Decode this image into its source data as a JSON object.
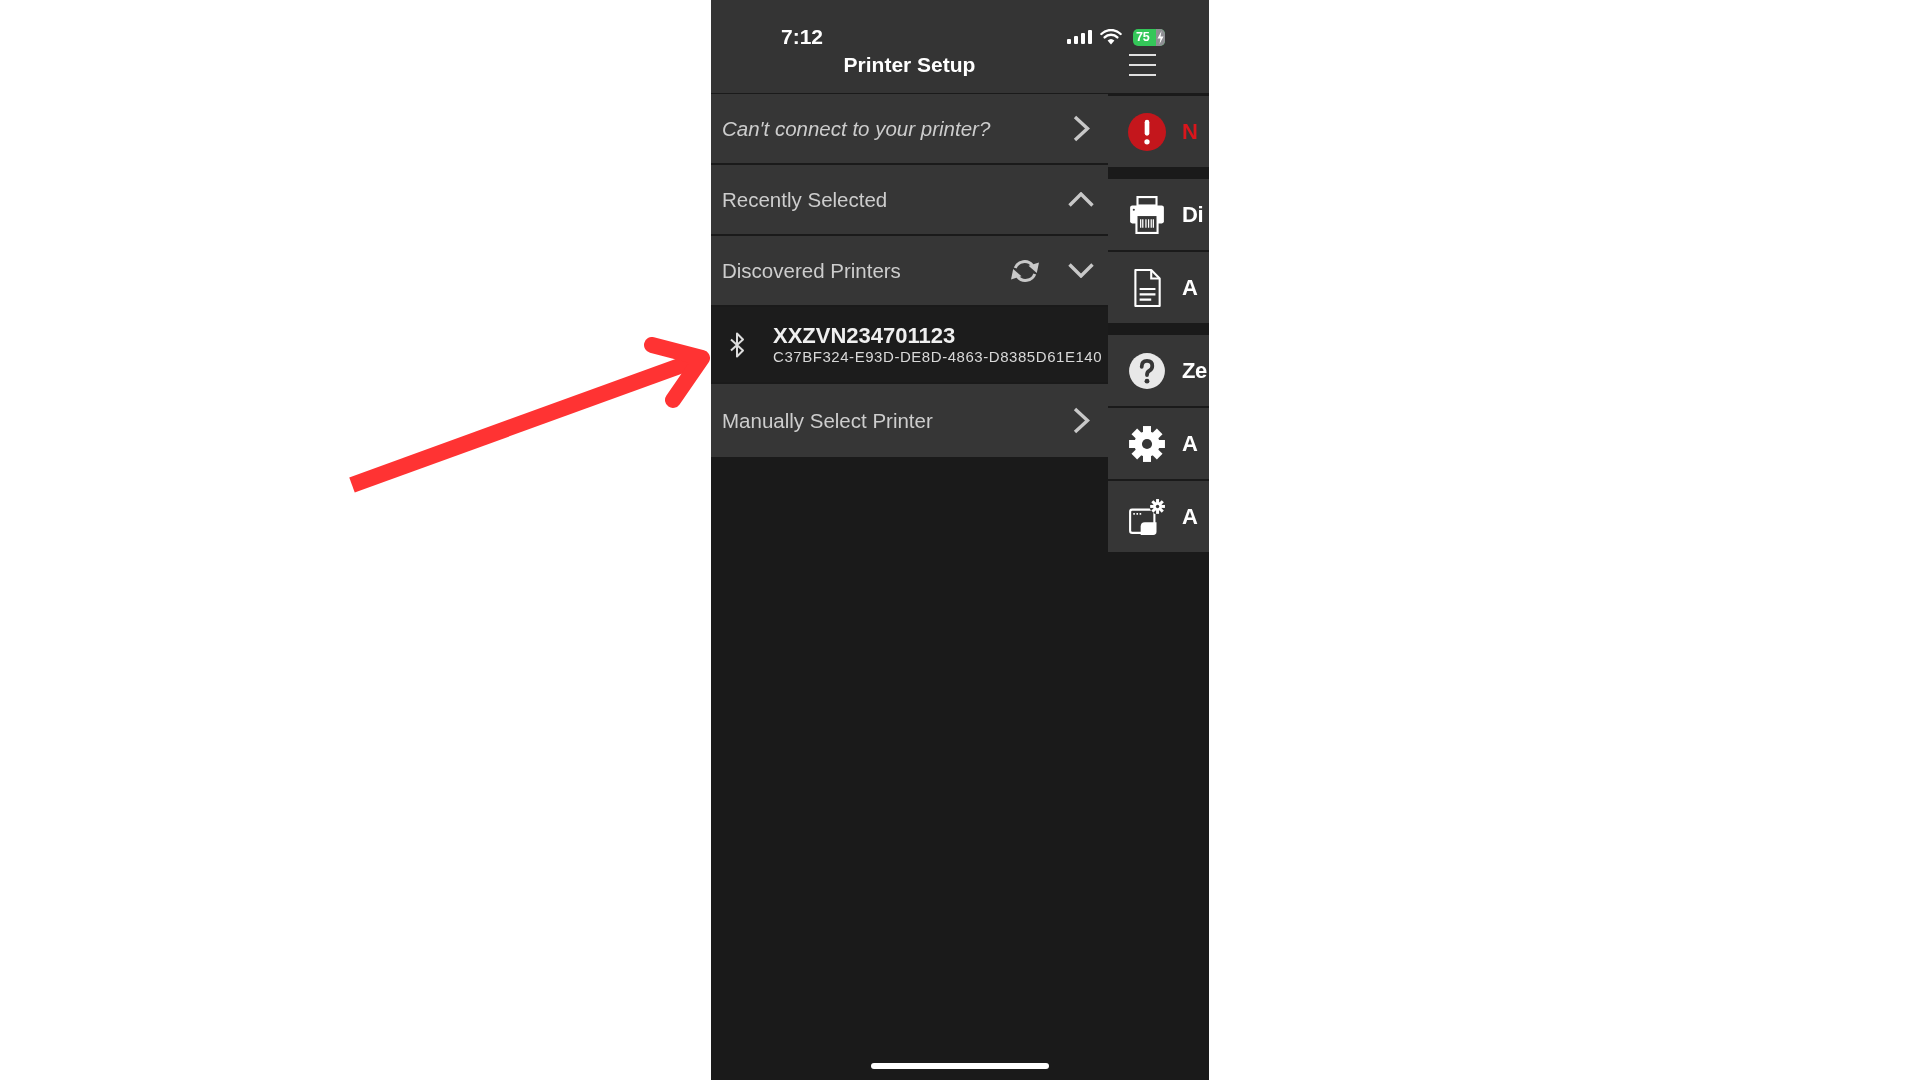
{
  "status_bar": {
    "time": "7:12",
    "battery": "75",
    "charging": true
  },
  "header": {
    "title": "Printer Setup"
  },
  "list": [
    {
      "kind": "help",
      "label": "Can't connect to your printer?"
    },
    {
      "kind": "section",
      "label": "Recently Selected",
      "expanded": false,
      "refresh": false
    },
    {
      "kind": "section",
      "label": "Discovered Printers",
      "expanded": true,
      "refresh": true,
      "printers": [
        {
          "kind": "bluetooth",
          "name": "XXZVN234701123",
          "id": "C37BF324-E93D-DE8D-4863-D8385D61E140"
        }
      ]
    },
    {
      "kind": "link",
      "label": "Manually Select Printer"
    }
  ],
  "menu": {
    "groups": [
      {
        "items": [
          {
            "kind": "alert",
            "label": "N"
          }
        ]
      },
      {
        "items": [
          {
            "kind": "printer",
            "label": "Di"
          },
          {
            "kind": "document",
            "label": "A"
          }
        ]
      },
      {
        "items": [
          {
            "kind": "help",
            "label": "Ze"
          },
          {
            "kind": "settings",
            "label": "A"
          },
          {
            "kind": "about",
            "label": "A"
          }
        ]
      }
    ]
  },
  "annotation": {
    "kind": "arrow"
  }
}
